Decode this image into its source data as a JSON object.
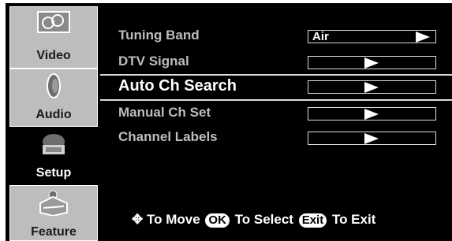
{
  "sidebar": {
    "tabs": [
      {
        "label": "Video",
        "icon": "video-icon"
      },
      {
        "label": "Audio",
        "icon": "speaker-icon"
      },
      {
        "label": "Setup",
        "icon": "setup-icon"
      },
      {
        "label": "Feature",
        "icon": "feature-icon"
      }
    ]
  },
  "menu": {
    "items": [
      {
        "label": "Tuning Band",
        "value": "Air"
      },
      {
        "label": "DTV Signal",
        "value": ""
      },
      {
        "label": "Auto Ch Search",
        "value": ""
      },
      {
        "label": "Manual Ch Set",
        "value": ""
      },
      {
        "label": "Channel Labels",
        "value": ""
      }
    ]
  },
  "footer": {
    "move_icon": "move-arrows-icon",
    "move_text": "To Move",
    "ok_label": "OK",
    "select_text": "To Select",
    "exit_label": "Exit",
    "exit_text": "To Exit"
  },
  "colors": {
    "background": "#000000",
    "sidebar_tab": "#bdbdbd",
    "label": "#bdbdbd",
    "selected_label": "#ffffff"
  }
}
